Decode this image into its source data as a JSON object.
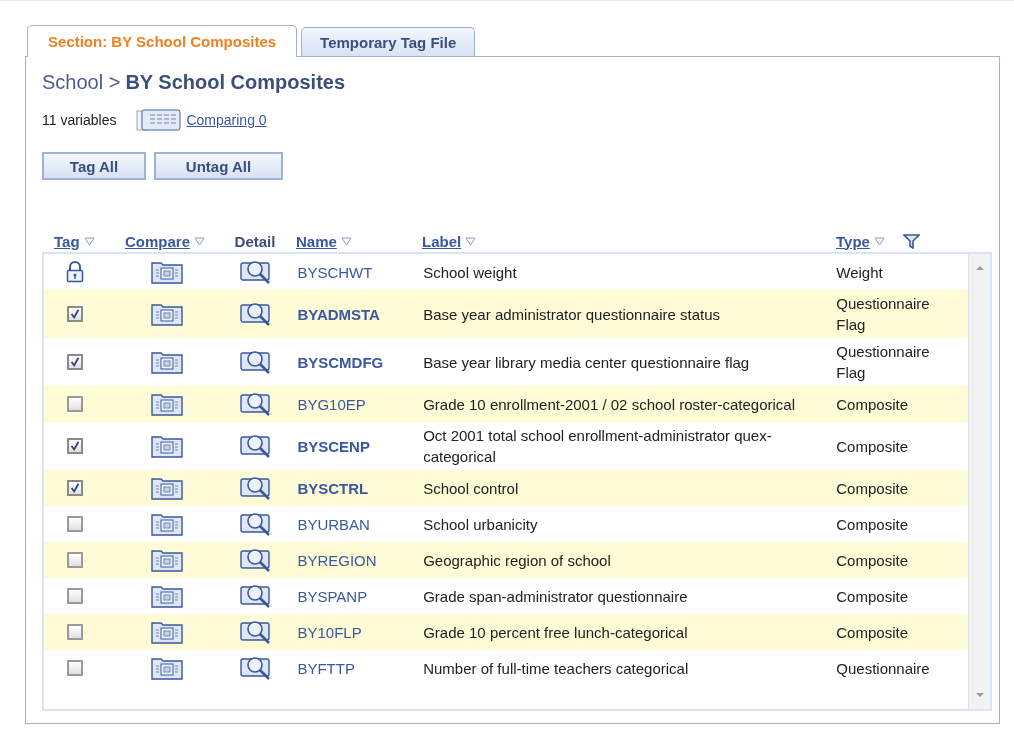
{
  "tabs": [
    {
      "label": "Section: BY School Composites",
      "selected": true
    },
    {
      "label": "Temporary Tag File",
      "selected": false
    }
  ],
  "breadcrumb": {
    "parent": "School >",
    "current": "BY School Composites"
  },
  "variable_count": "11 variables",
  "comparing_link": "Comparing 0",
  "buttons": [
    "Tag All",
    "Untag All"
  ],
  "columns": [
    {
      "label": "Tag",
      "sortable": true
    },
    {
      "label": "Compare",
      "sortable": true
    },
    {
      "label": "Detail",
      "sortable": false
    },
    {
      "label": "Name",
      "sortable": true
    },
    {
      "label": "Label",
      "sortable": true
    },
    {
      "label": "Type",
      "sortable": true
    }
  ],
  "rows": [
    {
      "kind": "locked",
      "name": "BYSCHWT",
      "label": "School weight",
      "type": "Weight"
    },
    {
      "kind": "checkbox",
      "checked": true,
      "name": "BYADMSTA",
      "label": "Base year administrator questionnaire status",
      "type": "Questionnaire Flag"
    },
    {
      "kind": "checkbox",
      "checked": true,
      "name": "BYSCMDFG",
      "label": "Base year library media center questionnaire flag",
      "type": "Questionnaire Flag"
    },
    {
      "kind": "checkbox",
      "checked": false,
      "name": "BYG10EP",
      "label": "Grade 10 enrollment-2001 / 02 school roster-categorical",
      "type": "Composite"
    },
    {
      "kind": "checkbox",
      "checked": true,
      "name": "BYSCENP",
      "label": "Oct 2001 total school enrollment-administrator quex-categorical",
      "type": "Composite"
    },
    {
      "kind": "checkbox",
      "checked": true,
      "name": "BYSCTRL",
      "label": "School control",
      "type": "Composite"
    },
    {
      "kind": "checkbox",
      "checked": false,
      "name": "BYURBAN",
      "label": "School urbanicity",
      "type": "Composite"
    },
    {
      "kind": "checkbox",
      "checked": false,
      "name": "BYREGION",
      "label": "Geographic region of school",
      "type": "Composite"
    },
    {
      "kind": "checkbox",
      "checked": false,
      "name": "BYSPANP",
      "label": "Grade span-administrator questionnaire",
      "type": "Composite"
    },
    {
      "kind": "checkbox",
      "checked": false,
      "name": "BY10FLP",
      "label": "Grade 10 percent free lunch-categorical",
      "type": "Composite"
    },
    {
      "kind": "checkbox",
      "checked": false,
      "name": "BYFTTP",
      "label": "Number of full-time teachers categorical",
      "type": "Questionnaire"
    }
  ]
}
